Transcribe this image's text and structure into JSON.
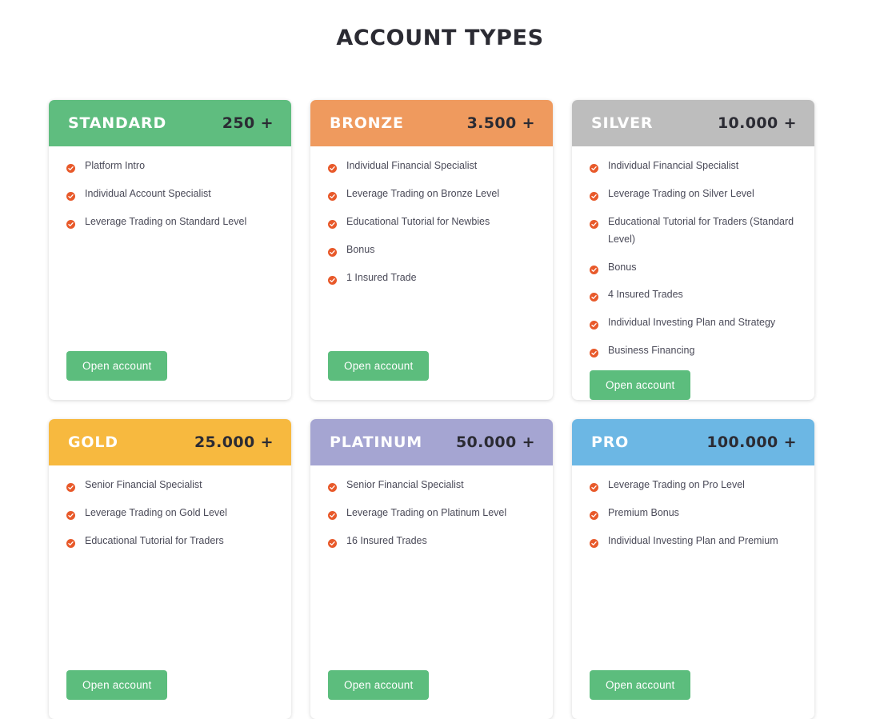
{
  "page": {
    "title": "ACCOUNT TYPES"
  },
  "icons": {
    "check": "check-circle-icon"
  },
  "colors": {
    "standard": "#5fbd7f",
    "bronze": "#ef9a5e",
    "silver": "#bdbdbd",
    "gold": "#f7b93f",
    "platinum": "#a5a5d2",
    "pro": "#6cb7e4",
    "check_icon": "#e8592a",
    "button": "#5cbd7d",
    "name_text": "#ffffff",
    "price_text": "#2b2b33",
    "feature_text": "#4a4a58"
  },
  "cards": [
    {
      "name": "STANDARD",
      "price": "250 +",
      "accent": "#5fbd7f",
      "button_label": "Open account",
      "features": [
        "Platform Intro",
        "Individual Account Specialist",
        "Leverage Trading on Standard Level"
      ]
    },
    {
      "name": "BRONZE",
      "price": "3.500 +",
      "accent": "#ef9a5e",
      "button_label": "Open account",
      "features": [
        "Individual Financial Specialist",
        "Leverage Trading on Bronze Level",
        "Educational Tutorial for Newbies",
        "Bonus",
        "1 Insured Trade"
      ]
    },
    {
      "name": "SILVER",
      "price": "10.000 +",
      "accent": "#bdbdbd",
      "button_label": "Open account",
      "features": [
        "Individual Financial Specialist",
        "Leverage Trading on Silver Level",
        "Educational Tutorial for Traders (Standard Level)",
        "Bonus",
        "4 Insured Trades",
        "Individual Investing Plan and Strategy",
        "Business Financing"
      ]
    },
    {
      "name": "GOLD",
      "price": "25.000 +",
      "accent": "#f7b93f",
      "button_label": "Open account",
      "features": [
        "Senior Financial Specialist",
        "Leverage Trading on Gold Level",
        "Educational Tutorial for Traders"
      ]
    },
    {
      "name": "PLATINUM",
      "price": "50.000 +",
      "accent": "#a5a5d2",
      "button_label": "Open account",
      "features": [
        "Senior Financial Specialist",
        "Leverage Trading on Platinum Level",
        "16 Insured Trades"
      ]
    },
    {
      "name": "PRO",
      "price": "100.000 +",
      "accent": "#6cb7e4",
      "button_label": "Open account",
      "features": [
        "Leverage Trading on Pro Level",
        "Premium Bonus",
        "Individual Investing Plan and Premium"
      ]
    }
  ]
}
